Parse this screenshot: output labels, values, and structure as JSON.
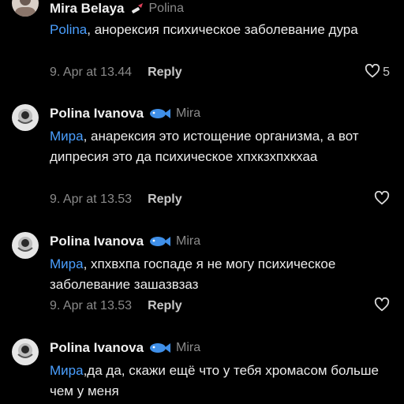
{
  "comments": [
    {
      "author": "Mira Belaya",
      "badge_icon": "lipstick-icon",
      "reply_to": "Polina",
      "mention": "Polina",
      "text": ", анорексия психическое заболевание дура",
      "time": "9. Apr at 13.44",
      "reply_label": "Reply",
      "likes": "5"
    },
    {
      "author": "Polina Ivanova",
      "badge_icon": "fish-icon",
      "reply_to": "Mira",
      "mention": "Мира",
      "text": ", анарексия это истощение организма, а вот дипресия это да психическое хпхкзхпхкхаа",
      "time": "9. Apr at 13.53",
      "reply_label": "Reply",
      "likes": ""
    },
    {
      "author": "Polina Ivanova",
      "badge_icon": "fish-icon",
      "reply_to": "Mira",
      "mention": "Мира",
      "text": ", хпхвхпа госпаде я не могу психическое заболевание зашазвзаз",
      "time": "9. Apr at 13.53",
      "reply_label": "Reply",
      "likes": ""
    },
    {
      "author": "Polina Ivanova",
      "badge_icon": "fish-icon",
      "reply_to": "Mira",
      "mention": "Мира",
      "text": ",да да, скажи ещё что у тебя хромасом больше чем у меня",
      "time": "",
      "reply_label": "",
      "likes": ""
    }
  ],
  "colors": {
    "background": "#000000",
    "mention": "#4a9fff",
    "muted": "#8a8a8a",
    "fish_blue": "#3f8fe8"
  }
}
